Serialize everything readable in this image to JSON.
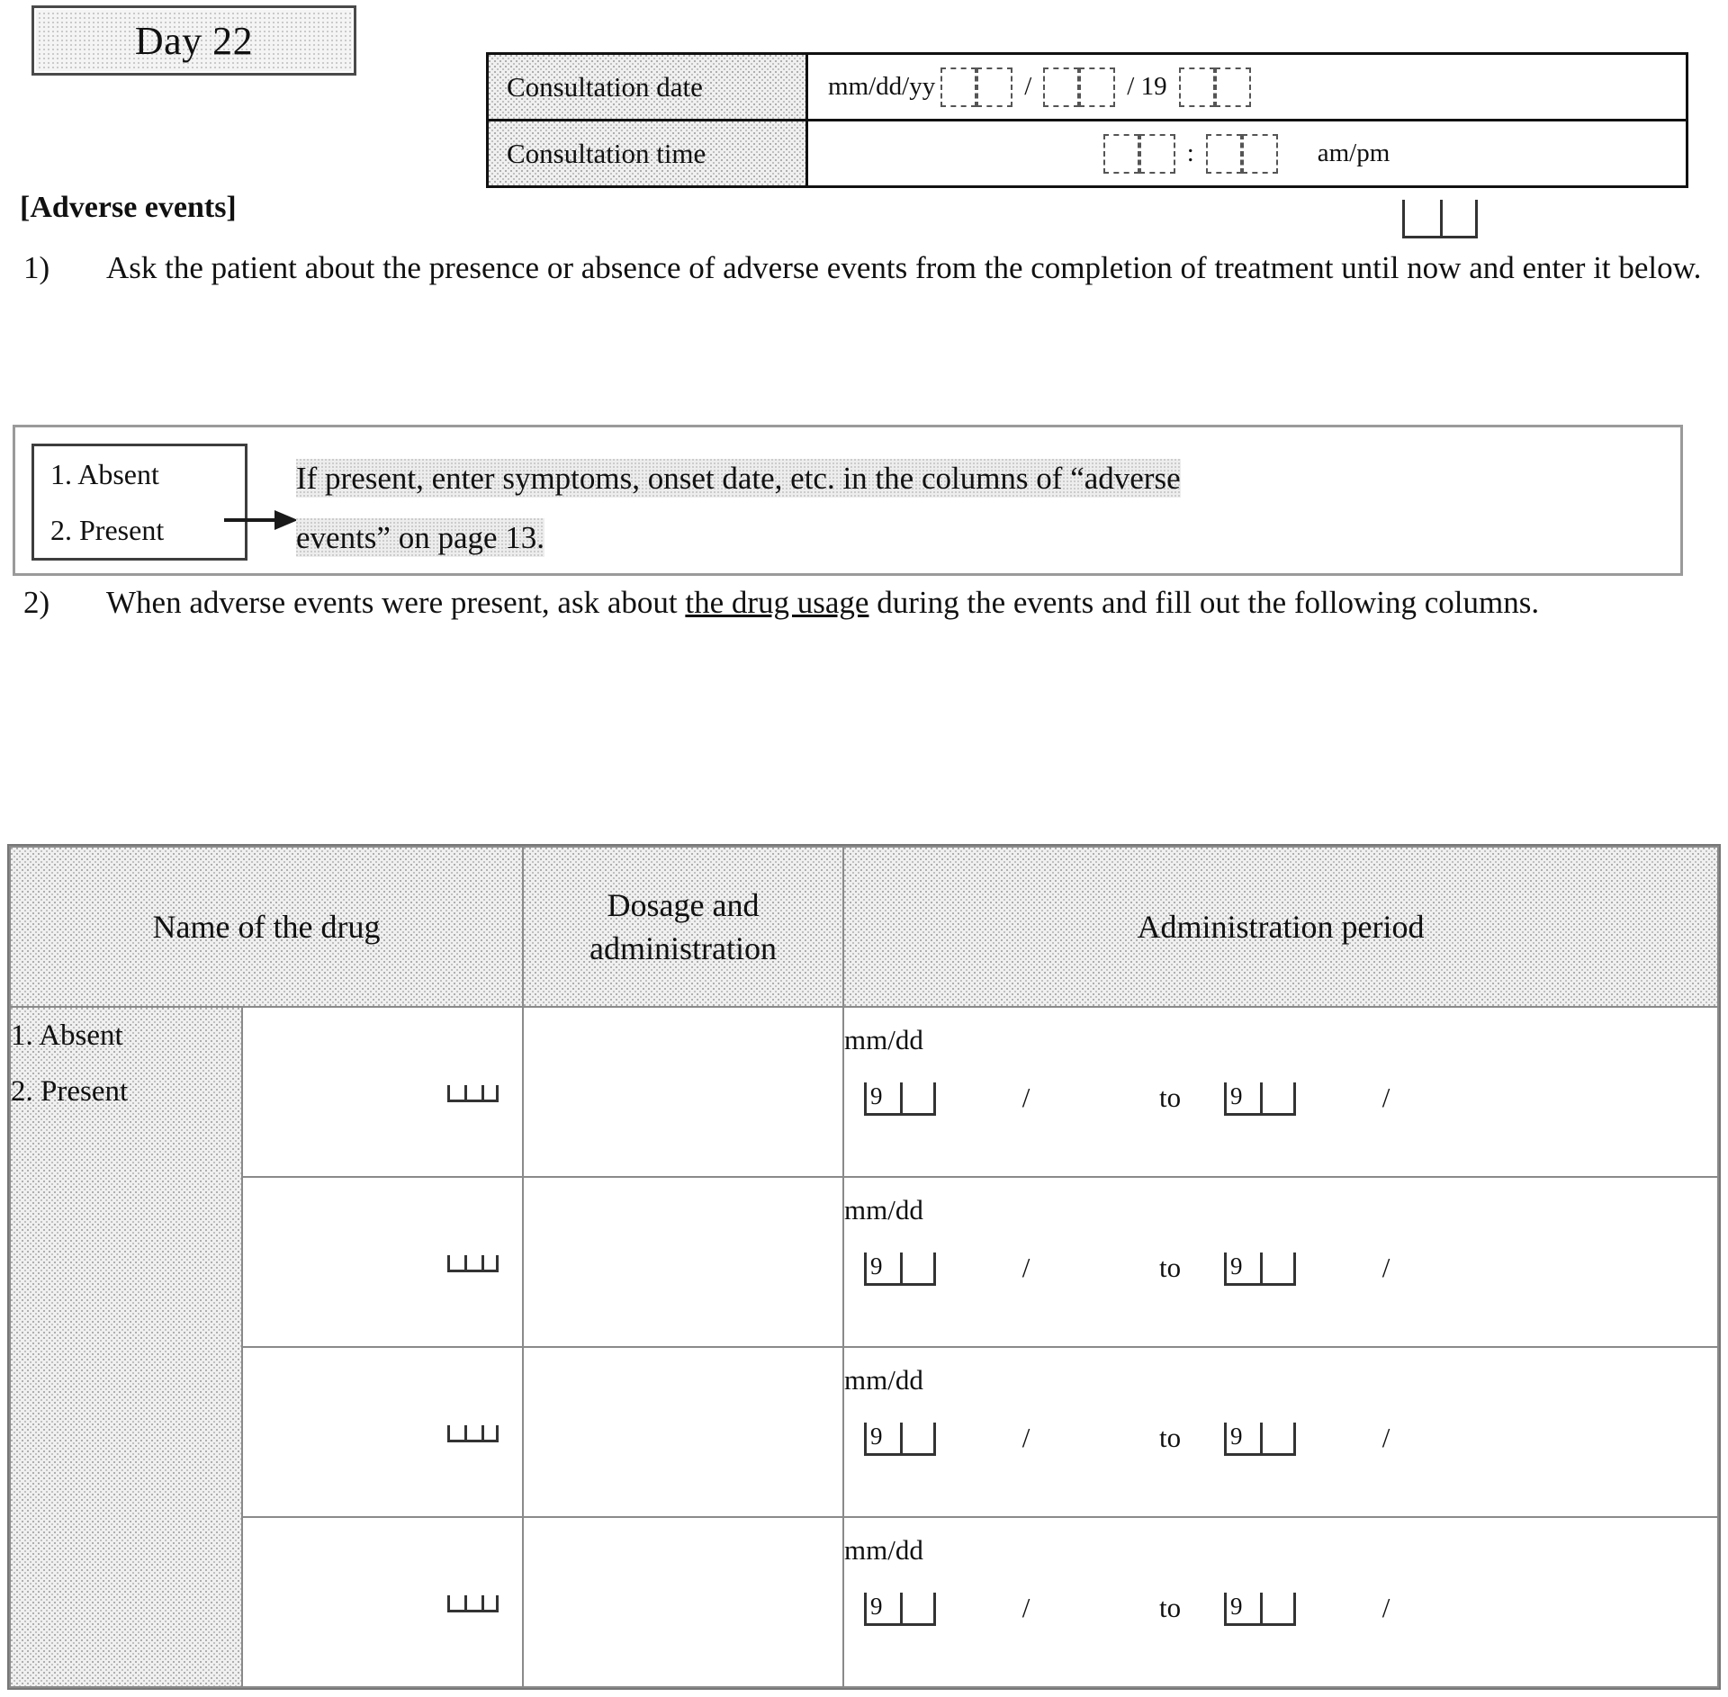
{
  "day_badge": {
    "label": "Day 22"
  },
  "consultation": {
    "rows": [
      {
        "label": "Consultation date",
        "format": "mm/dd/yy",
        "year_prefix": "19",
        "sep1": "/",
        "sep2": "/ 19"
      },
      {
        "label": "Consultation time",
        "sep": ":",
        "suffix": "am/pm"
      }
    ]
  },
  "adverse": {
    "heading": "[Adverse events]",
    "item1": {
      "number": "1)",
      "text": "Ask the patient about the presence or absence of adverse events from the completion of treatment until now and enter it below."
    },
    "item2": {
      "number": "2)",
      "text_before": "When adverse events were present, ask about ",
      "text_underlined": "the drug usage",
      "text_after": " during the events and fill out the following columns."
    },
    "choice": {
      "option1": "1. Absent",
      "option2": "2. Present"
    },
    "callout_line1": "If present, enter symptoms, onset date, etc. in the columns of “adverse",
    "callout_line2": "events” on page 13."
  },
  "table": {
    "headers": {
      "status": "",
      "name": "Name of the drug",
      "dosage": "Dosage and administration",
      "period": "Administration period"
    },
    "status_cell": {
      "option1": "1. Absent",
      "option2": "2. Present"
    },
    "rows": [
      {
        "mmdd": "mm/dd",
        "start_digit": "9",
        "slash1": "/",
        "to": "to",
        "end_digit": "9",
        "slash2": "/"
      },
      {
        "mmdd": "mm/dd",
        "start_digit": "9",
        "slash1": "/",
        "to": "to",
        "end_digit": "9",
        "slash2": "/"
      },
      {
        "mmdd": "mm/dd",
        "start_digit": "9",
        "slash1": "/",
        "to": "to",
        "end_digit": "9",
        "slash2": "/"
      },
      {
        "mmdd": "mm/dd",
        "start_digit": "9",
        "slash1": "/",
        "to": "to",
        "end_digit": "9",
        "slash2": "/"
      }
    ]
  },
  "colors": {
    "ink": "#111111",
    "rule": "#8a8a8a",
    "screen": "#f0f0f0"
  }
}
